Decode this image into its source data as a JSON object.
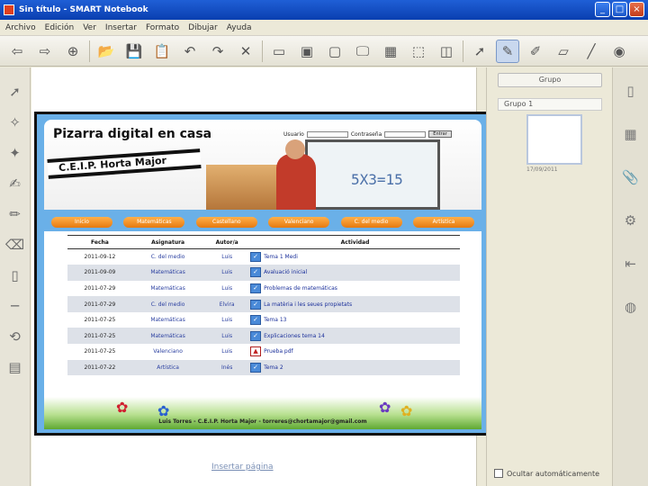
{
  "window": {
    "title": "Sin título - SMART Notebook"
  },
  "menu": [
    "Archivo",
    "Edición",
    "Ver",
    "Insertar",
    "Formato",
    "Dibujar",
    "Ayuda"
  ],
  "canvas": {
    "add_page_label": "Insertar página"
  },
  "webpage": {
    "title": "Pizarra digital en casa",
    "school": "C.E.I.P. Horta Major",
    "user_label": "Usuario",
    "password_label": "Contraseña",
    "enter_label": "Entrar",
    "board_text": "5X3=15",
    "nav": [
      "Inicio",
      "Matemáticas",
      "Castellano",
      "Valenciano",
      "C. del medio",
      "Artística"
    ],
    "table": {
      "headers": [
        "Fecha",
        "Asignatura",
        "Autor/a",
        "Actividad"
      ],
      "rows": [
        {
          "date": "2011-09-12",
          "subject": "C. del medio",
          "author": "Luis",
          "activity": "Tema 1 Medi",
          "type": "doc"
        },
        {
          "date": "2011-09-09",
          "subject": "Matemáticas",
          "author": "Luis",
          "activity": "Avaluació inicial",
          "type": "doc"
        },
        {
          "date": "2011-07-29",
          "subject": "Matemáticas",
          "author": "Luis",
          "activity": "Problemas de matemáticas",
          "type": "doc"
        },
        {
          "date": "2011-07-29",
          "subject": "C. del medio",
          "author": "Elvira",
          "activity": "La matèria i les seues propietats",
          "type": "doc"
        },
        {
          "date": "2011-07-25",
          "subject": "Matemáticas",
          "author": "Luis",
          "activity": "Tema 13",
          "type": "doc"
        },
        {
          "date": "2011-07-25",
          "subject": "Matemáticas",
          "author": "Luis",
          "activity": "Explicaciones tema 14",
          "type": "doc"
        },
        {
          "date": "2011-07-25",
          "subject": "Valenciano",
          "author": "Luis",
          "activity": "Prueba pdf",
          "type": "pdf"
        },
        {
          "date": "2011-07-22",
          "subject": "Artística",
          "author": "Inés",
          "activity": "Tema 2",
          "type": "doc"
        }
      ]
    },
    "footer": "Luis Torres - C.E.I.P. Horta Major - torreres@chortamajor@gmail.com"
  },
  "sidepanel": {
    "group_button": "Grupo",
    "group_label": "Grupo 1",
    "thumb_label": "17/09/2011",
    "autohide_label": "Ocultar automáticamente"
  }
}
